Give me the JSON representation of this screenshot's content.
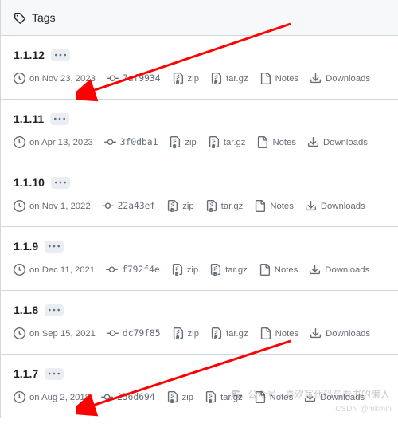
{
  "header": {
    "title": "Tags"
  },
  "labels": {
    "zip": "zip",
    "targz": "tar.gz",
    "notes": "Notes",
    "downloads": "Downloads"
  },
  "tags": [
    {
      "name": "1.1.12",
      "date": "on Nov 23, 2023",
      "commit": "7af9934"
    },
    {
      "name": "1.1.11",
      "date": "on Apr 13, 2023",
      "commit": "3f0dba1"
    },
    {
      "name": "1.1.10",
      "date": "on Nov 1, 2022",
      "commit": "22a43ef"
    },
    {
      "name": "1.1.9",
      "date": "on Dec 11, 2021",
      "commit": "f792f4e"
    },
    {
      "name": "1.1.8",
      "date": "on Sep 15, 2021",
      "commit": "dc79f85"
    },
    {
      "name": "1.1.7",
      "date": "on Aug 2, 2018",
      "commit": "256d694"
    }
  ],
  "watermark": {
    "text1": "公众号 · 喜欢写代码与看书的懒人",
    "text2": "CSDN @mkmin"
  }
}
